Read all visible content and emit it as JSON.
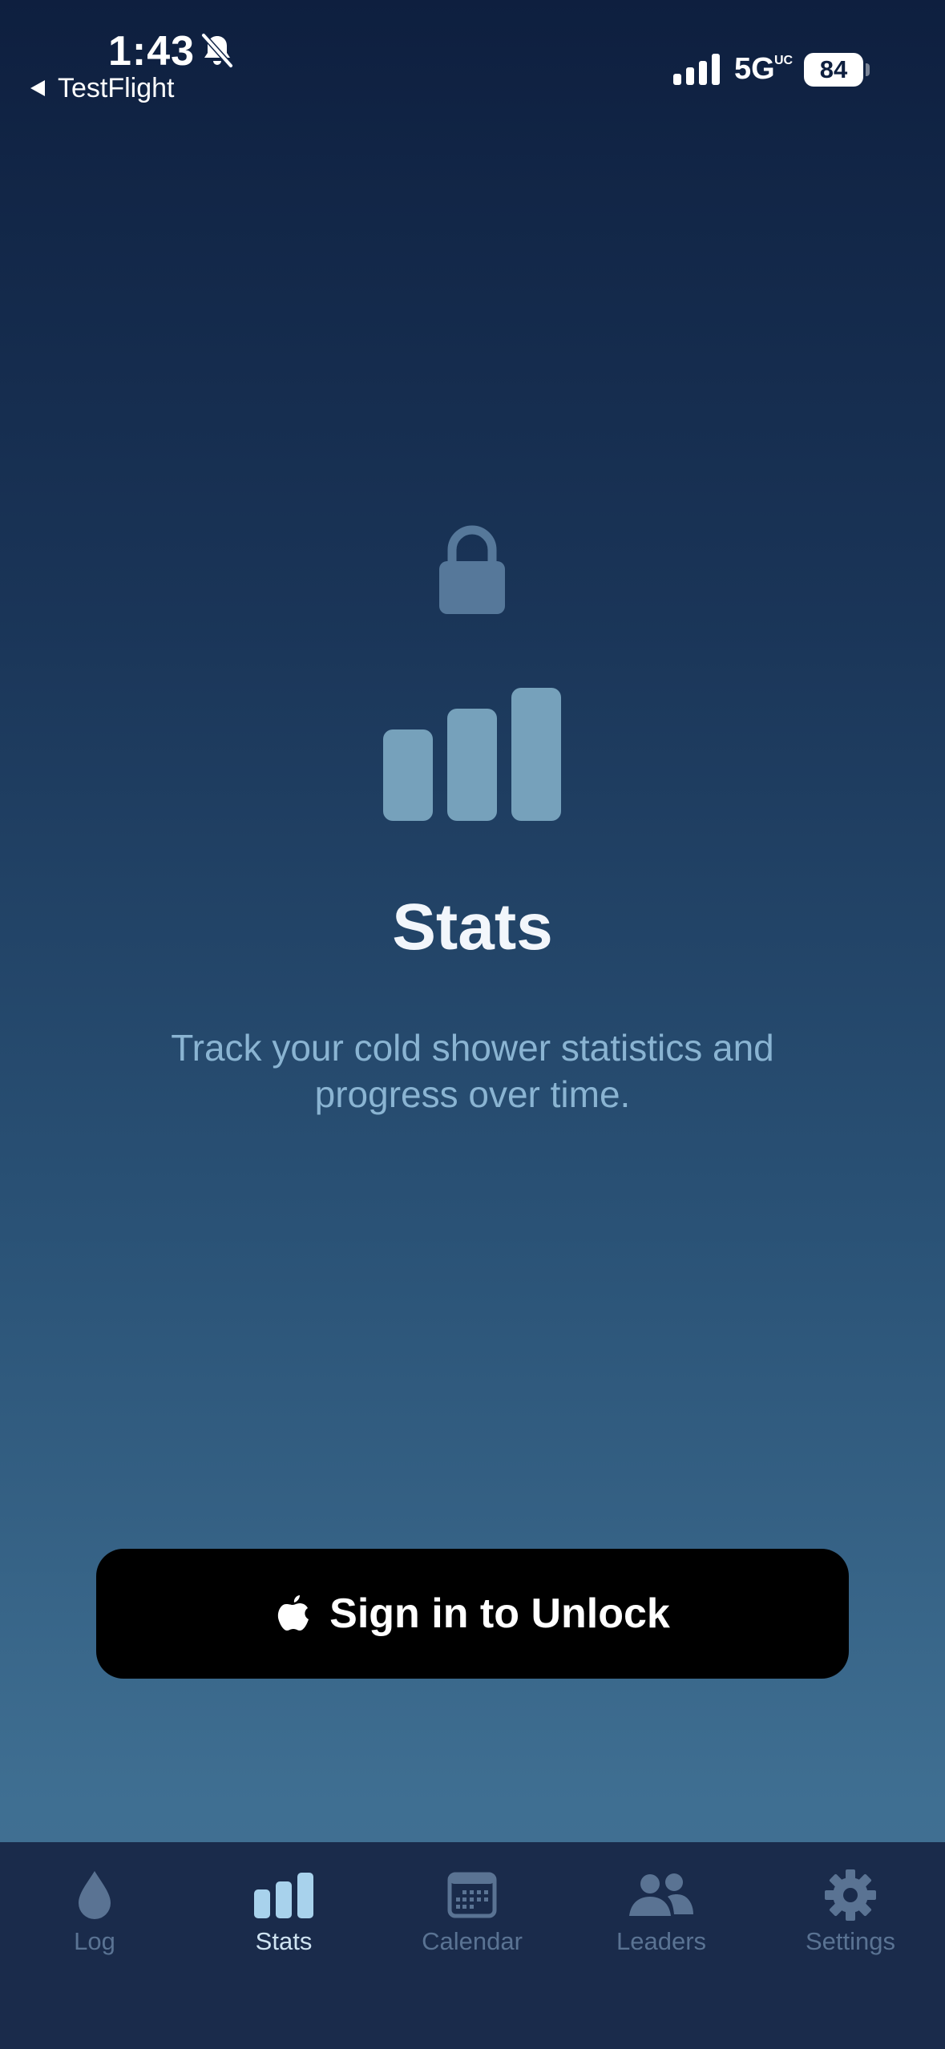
{
  "status_bar": {
    "time": "1:43",
    "back_app": "TestFlight",
    "network": "5G",
    "network_sup": "UC",
    "battery": "84"
  },
  "content": {
    "title": "Stats",
    "description": "Track your cold shower statistics and progress over time."
  },
  "sign_in": {
    "label": "Sign in to Unlock"
  },
  "tab_bar": {
    "active": "Stats",
    "tabs": [
      {
        "label": "Log",
        "icon": "water-drop-icon"
      },
      {
        "label": "Stats",
        "icon": "bar-chart-icon"
      },
      {
        "label": "Calendar",
        "icon": "calendar-icon"
      },
      {
        "label": "Leaders",
        "icon": "people-icon"
      },
      {
        "label": "Settings",
        "icon": "gear-icon"
      }
    ]
  },
  "colors": {
    "background_top": "#0e1f3f",
    "background_bottom": "#436f93",
    "tab_bar": "#1a2b4b",
    "tab_inactive": "#5a7393",
    "tab_active": "#cfe3f1",
    "icon_muted": "#76a1bb",
    "description": "#8ab4d2",
    "button": "#000000"
  }
}
